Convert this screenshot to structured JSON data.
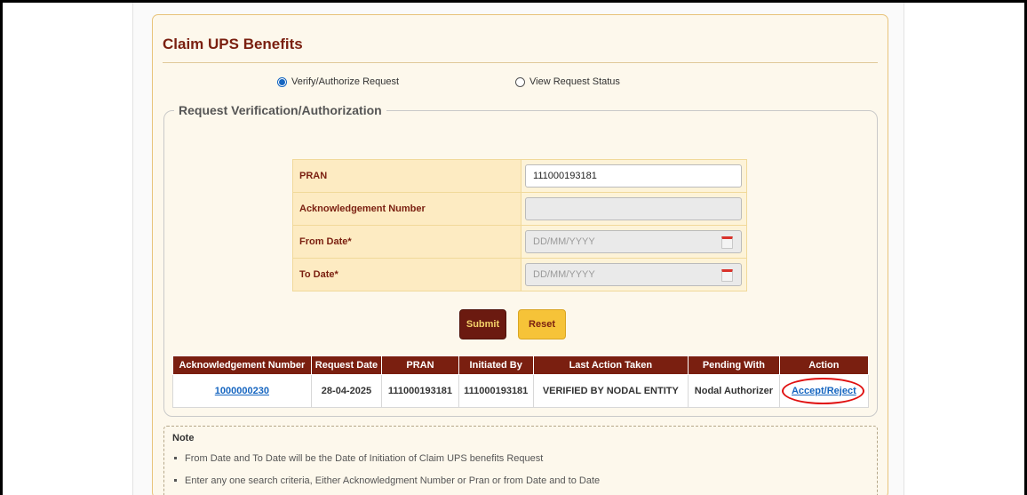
{
  "page": {
    "title": "Claim UPS Benefits"
  },
  "radios": [
    {
      "label": "Verify/Authorize Request",
      "checked": true
    },
    {
      "label": "View Request Status",
      "checked": false
    }
  ],
  "section": {
    "legend": "Request Verification/Authorization"
  },
  "form": {
    "pran": {
      "label": "PRAN",
      "value": "111000193181"
    },
    "ack": {
      "label": "Acknowledgement Number",
      "value": ""
    },
    "from_date": {
      "label": "From Date*",
      "placeholder": "DD/MM/YYYY"
    },
    "to_date": {
      "label": "To Date*",
      "placeholder": "DD/MM/YYYY"
    },
    "calendar_icon": "calendar-icon"
  },
  "buttons": {
    "submit": "Submit",
    "reset": "Reset"
  },
  "table": {
    "headers": [
      "Acknowledgement Number",
      "Request Date",
      "PRAN",
      "Initiated By",
      "Last Action Taken",
      "Pending With",
      "Action"
    ],
    "rows": [
      {
        "ack_number": "1000000230",
        "request_date": "28-04-2025",
        "pran": "111000193181",
        "initiated_by": "111000193181",
        "last_action": "VERIFIED BY NODAL ENTITY",
        "pending_with": "Nodal Authorizer",
        "action": "Accept/Reject"
      }
    ]
  },
  "note": {
    "title": "Note",
    "items": [
      "From Date and To Date will be the Date of Initiation of Claim UPS benefits Request",
      "Enter any one search criteria, Either Acknowledgment Number or Pran or from Date and to Date"
    ]
  },
  "colors": {
    "accent": "#7a1f10",
    "highlight": "#e01010",
    "link": "#1565c0"
  }
}
